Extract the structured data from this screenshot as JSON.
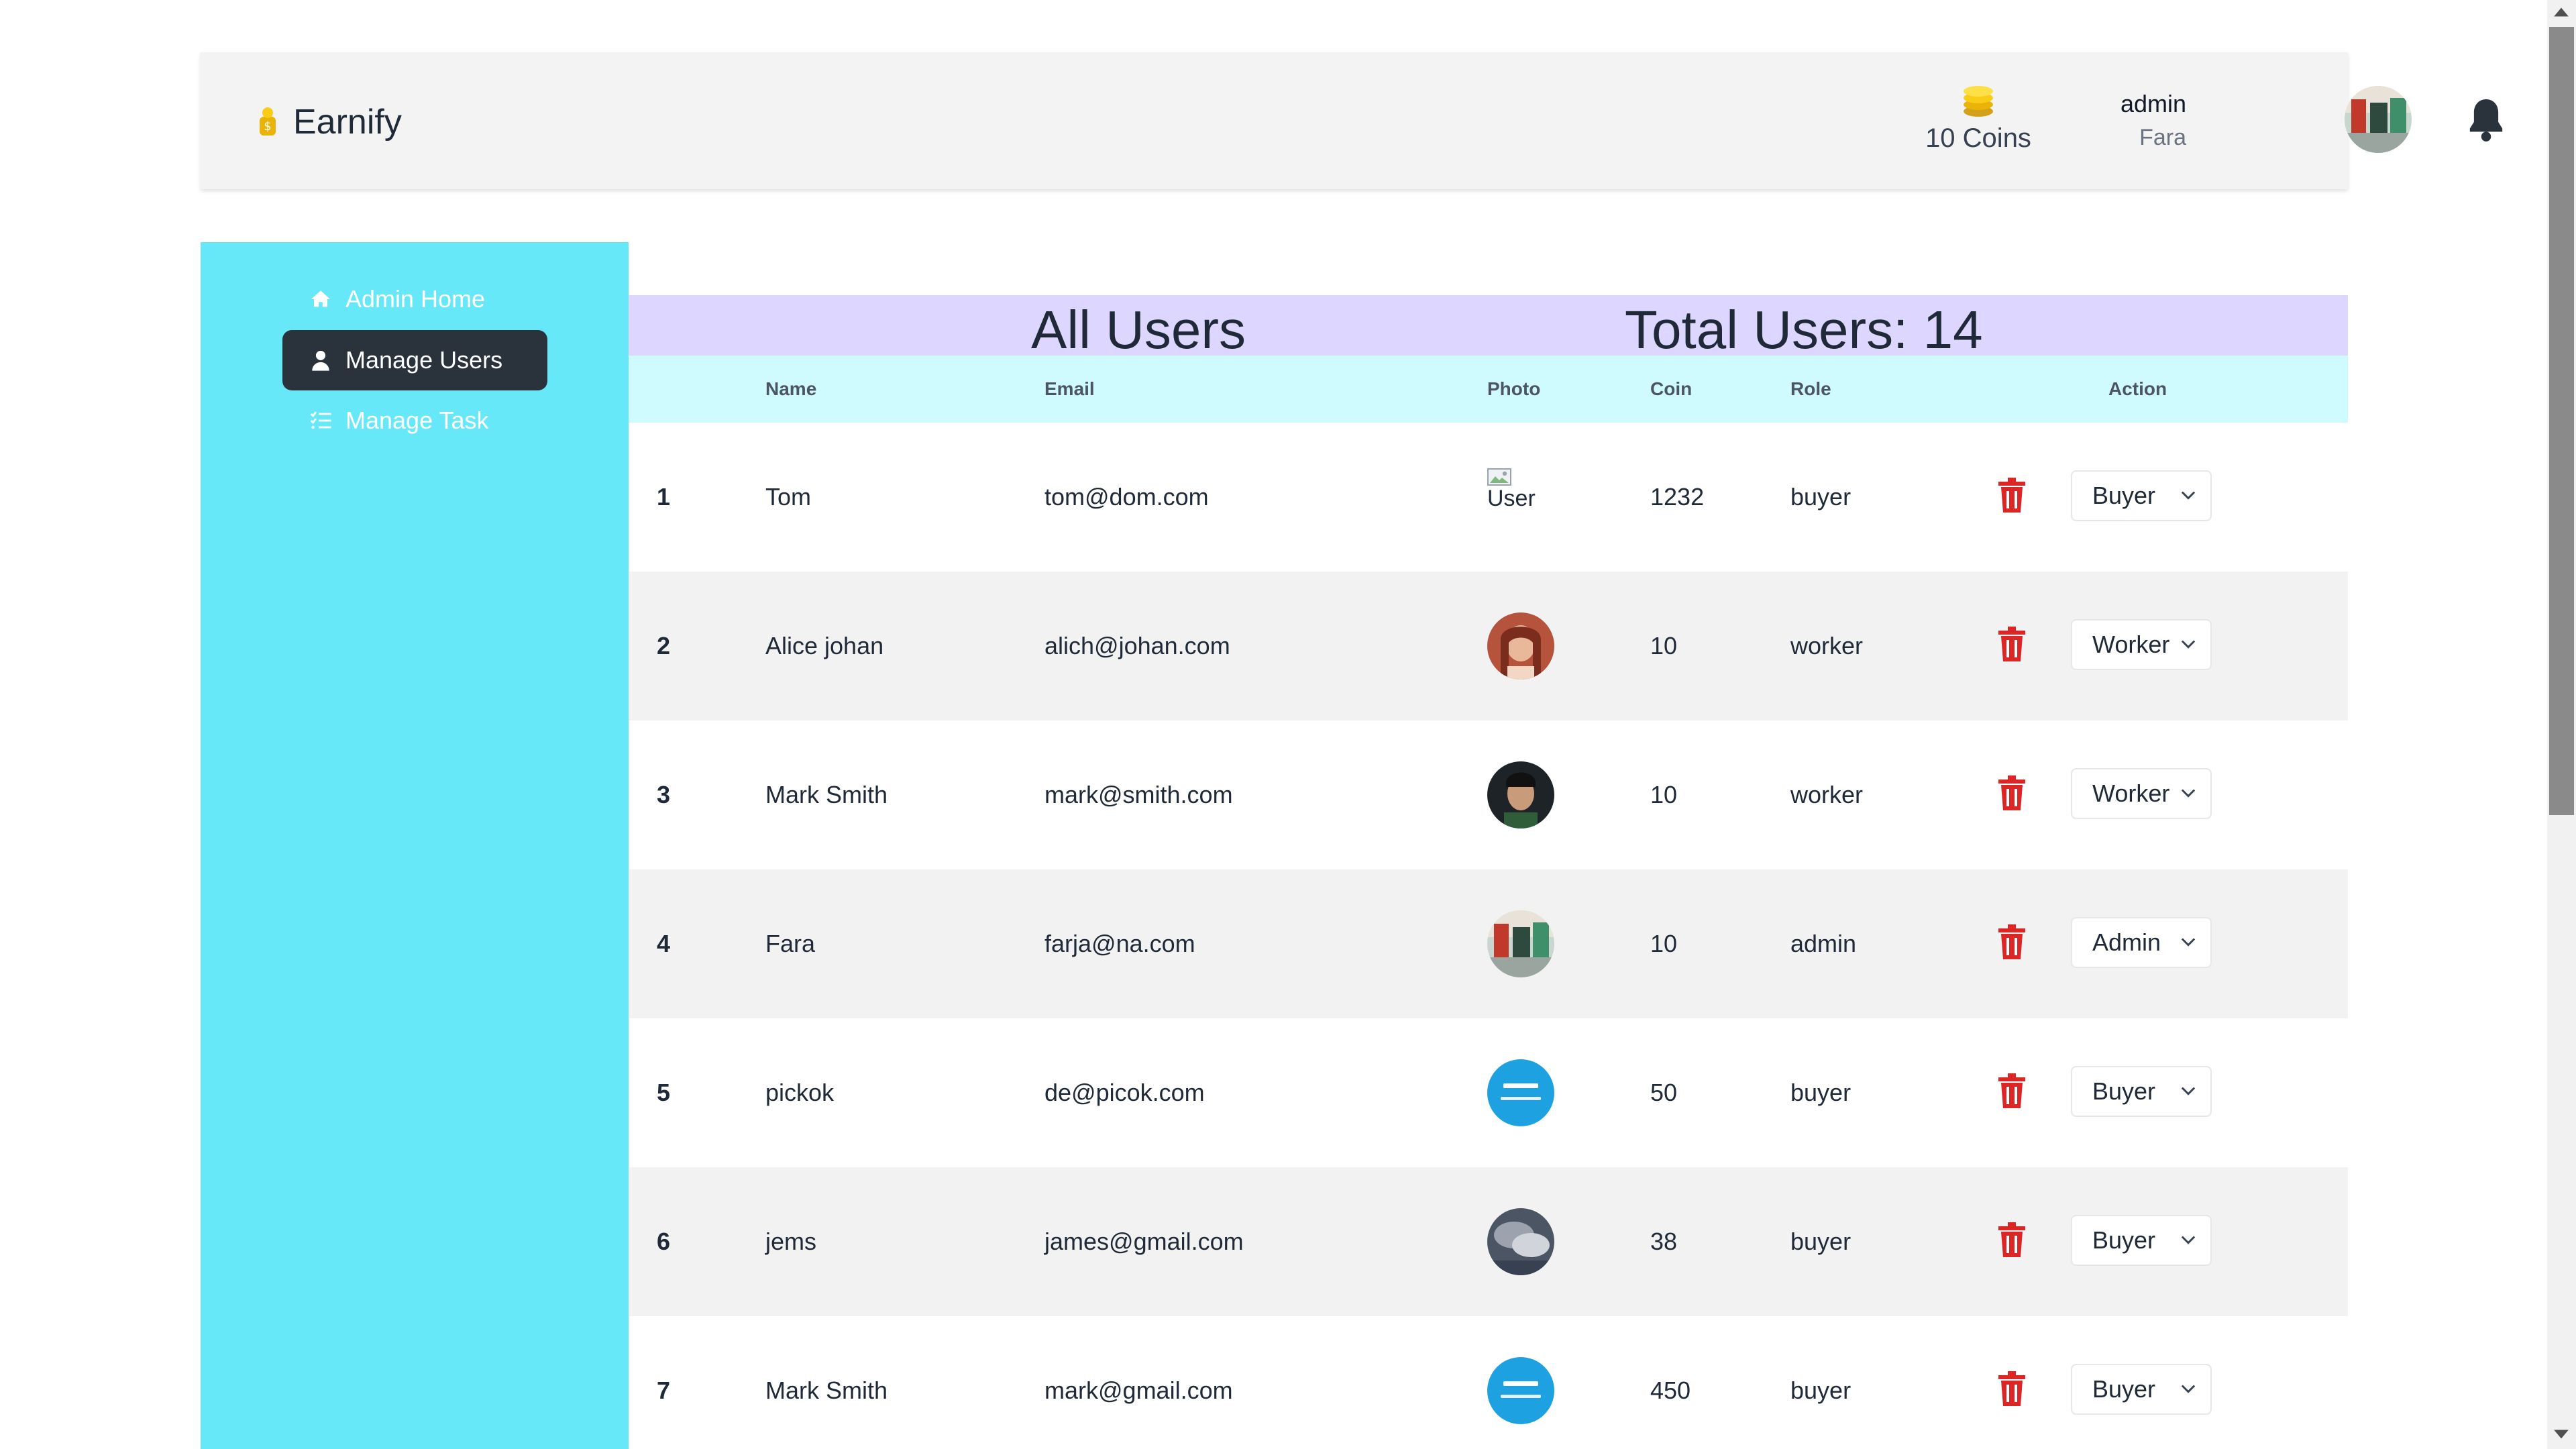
{
  "header": {
    "brand": "Earnify",
    "coins_label": "10 Coins",
    "user_role": "admin",
    "user_name": "Fara"
  },
  "sidebar": {
    "items": [
      {
        "label": "Admin Home",
        "icon": "home-icon",
        "active": false
      },
      {
        "label": "Manage Users",
        "icon": "user-icon",
        "active": true
      },
      {
        "label": "Manage Task",
        "icon": "list-check-icon",
        "active": false
      }
    ]
  },
  "main": {
    "title": "All Users",
    "total": "Total Users: 14"
  },
  "table": {
    "columns": [
      "Name",
      "Email",
      "Photo",
      "Coin",
      "Role",
      "Action"
    ],
    "rows": [
      {
        "no": "1",
        "name": "Tom",
        "email": "tom@dom.com",
        "photo": "broken",
        "photo_alt": "User",
        "coin": "1232",
        "role": "buyer",
        "select": "Buyer"
      },
      {
        "no": "2",
        "name": "Alice johan",
        "email": "alich@johan.com",
        "photo": "woman",
        "coin": "10",
        "role": "worker",
        "select": "Worker"
      },
      {
        "no": "3",
        "name": "Mark Smith",
        "email": "mark@smith.com",
        "photo": "man",
        "coin": "10",
        "role": "worker",
        "select": "Worker"
      },
      {
        "no": "4",
        "name": "Fara",
        "email": "farja@na.com",
        "photo": "market",
        "coin": "10",
        "role": "admin",
        "select": "Admin"
      },
      {
        "no": "5",
        "name": "pickok",
        "email": "de@picok.com",
        "photo": "imgbb",
        "coin": "50",
        "role": "buyer",
        "select": "Buyer"
      },
      {
        "no": "6",
        "name": "jems",
        "email": "james@gmail.com",
        "photo": "sky",
        "coin": "38",
        "role": "buyer",
        "select": "Buyer"
      },
      {
        "no": "7",
        "name": "Mark Smith",
        "email": "mark@gmail.com",
        "photo": "imgbb",
        "coin": "450",
        "role": "buyer",
        "select": "Buyer"
      }
    ]
  },
  "colors": {
    "sidebar": "#67e8f9",
    "title_bar": "#ddd6fe",
    "table_head": "#cffafe",
    "active_nav": "#2a323c",
    "trash": "#dc2626"
  }
}
